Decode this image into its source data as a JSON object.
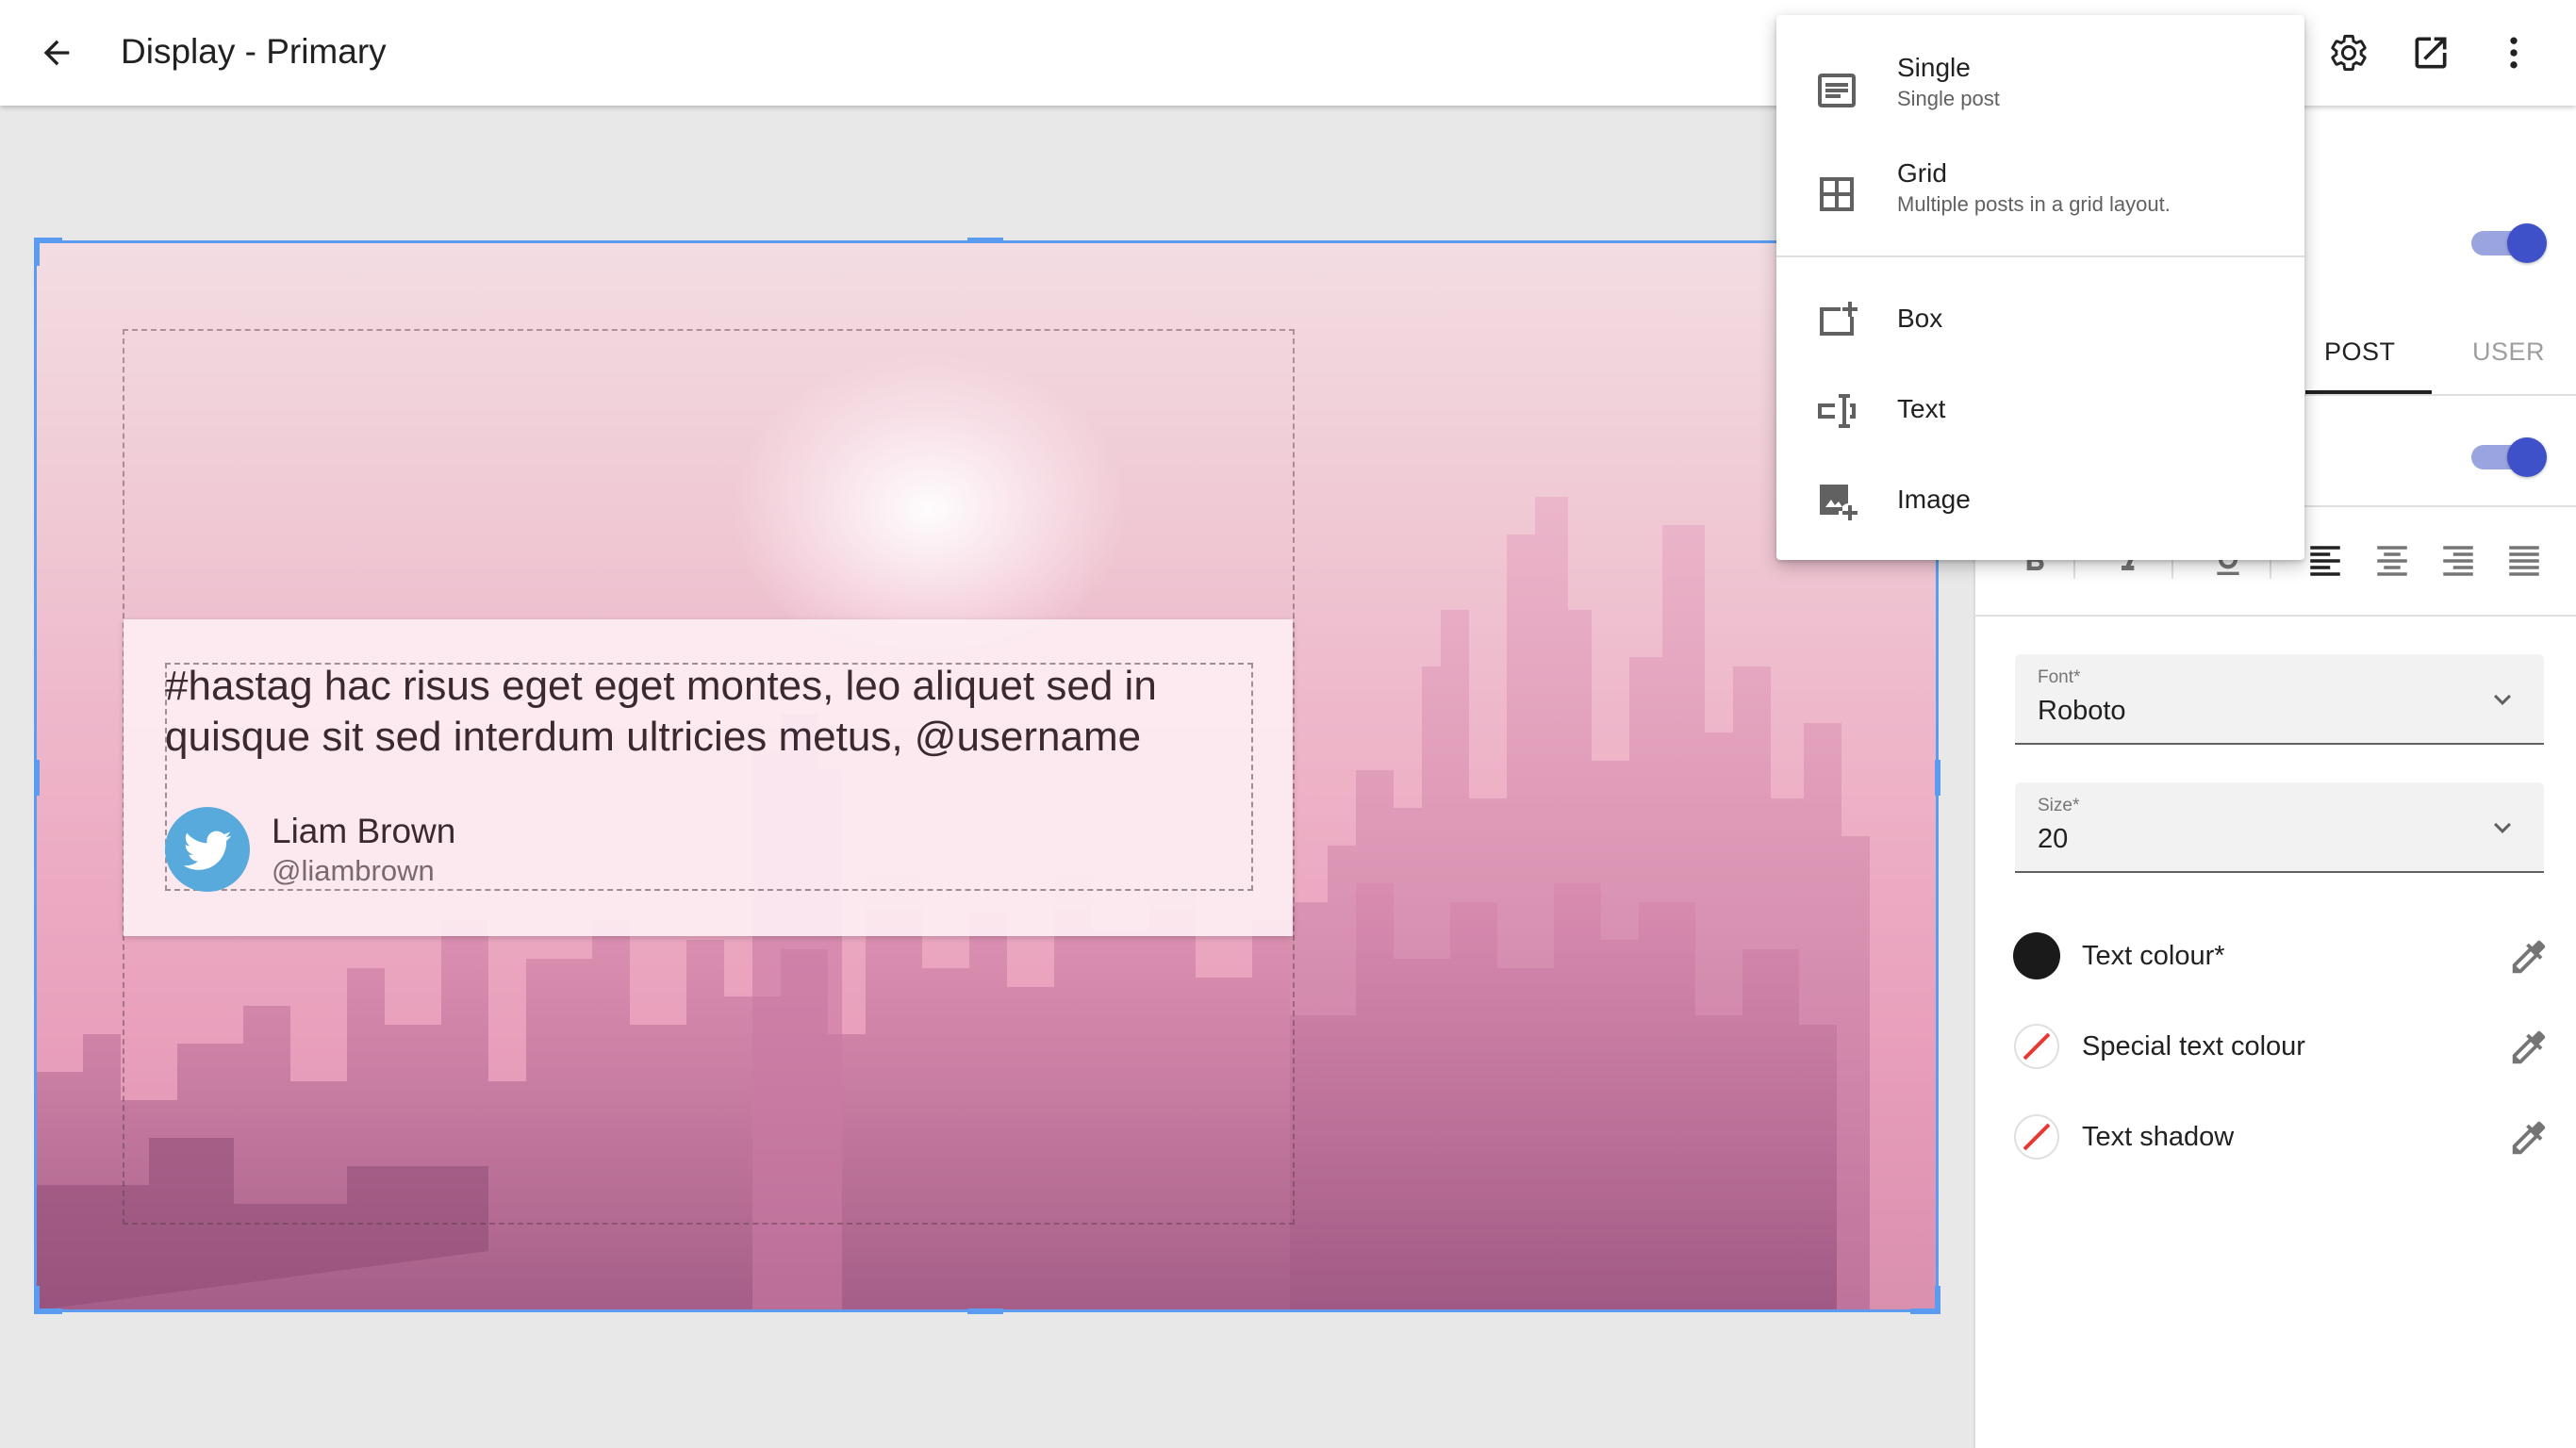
{
  "header": {
    "title": "Display - Primary"
  },
  "post": {
    "text": "#hastag hac risus eget eget montes, leo aliquet sed in quisque sit sed interdum ultricies metus, @username",
    "name": "Liam Brown",
    "handle": "@liambrown"
  },
  "panel": {
    "tabs": [
      {
        "label": "POST",
        "active": true
      },
      {
        "label": "USER",
        "active": false
      }
    ],
    "toggles": [
      true,
      true
    ],
    "alignment_selected": "left",
    "font": {
      "label": "Font*",
      "value": "Roboto"
    },
    "size": {
      "label": "Size*",
      "value": "20"
    },
    "colors": [
      {
        "label": "Text colour*",
        "swatch": "#1a1a1a"
      },
      {
        "label": "Special text colour",
        "swatch": "none"
      },
      {
        "label": "Text shadow",
        "swatch": "none"
      }
    ]
  },
  "menu": {
    "items": [
      {
        "label": "Single",
        "sub": "Single post",
        "icon": "single-post-icon"
      },
      {
        "label": "Grid",
        "sub": "Multiple posts in a grid layout.",
        "icon": "grid-icon"
      },
      {
        "label": "Box",
        "icon": "add-box-icon"
      },
      {
        "label": "Text",
        "icon": "text-field-icon"
      },
      {
        "label": "Image",
        "icon": "add-image-icon"
      }
    ]
  },
  "colors": {
    "accent": "#3f51c8",
    "selection": "#5b9cf0",
    "twitter": "#58a9dc"
  }
}
